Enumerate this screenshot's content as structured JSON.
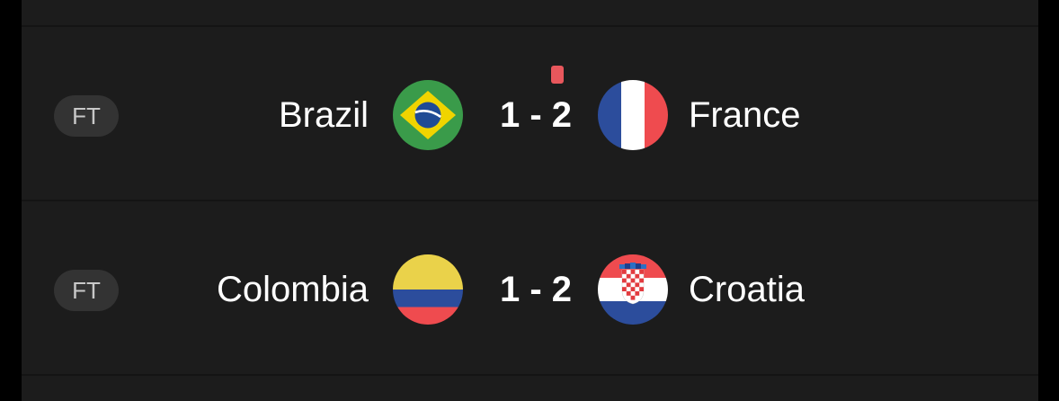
{
  "colors": {
    "background": "#1c1c1c",
    "divider": "#141414",
    "status_pill": "#333333",
    "red_card": "#e8575c"
  },
  "matches": [
    {
      "status": "FT",
      "home": {
        "name": "Brazil",
        "flag_icon": "brazil-flag-icon"
      },
      "away": {
        "name": "France",
        "flag_icon": "france-flag-icon"
      },
      "score": "1 - 2",
      "red_card_icon": "red-card-icon"
    },
    {
      "status": "FT",
      "home": {
        "name": "Colombia",
        "flag_icon": "colombia-flag-icon"
      },
      "away": {
        "name": "Croatia",
        "flag_icon": "croatia-flag-icon"
      },
      "score": "1 - 2"
    }
  ]
}
